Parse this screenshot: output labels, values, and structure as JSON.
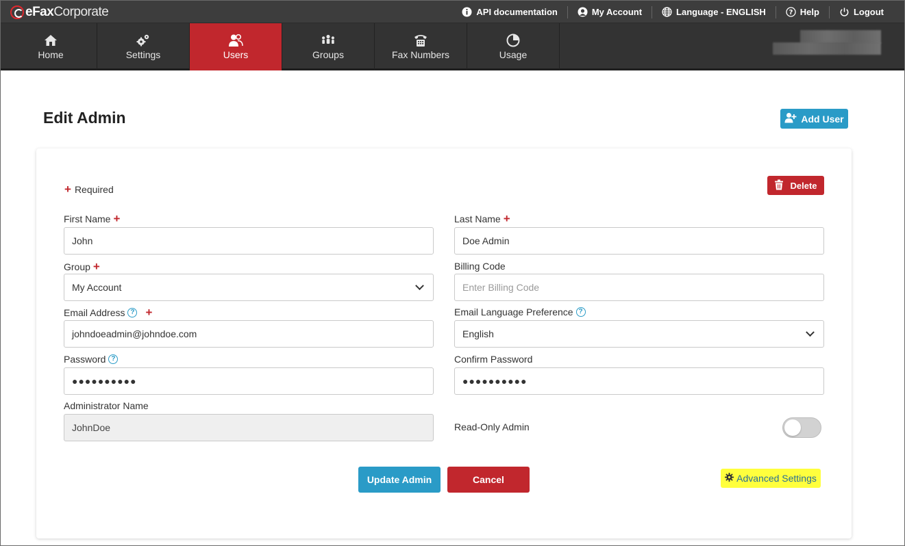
{
  "brand": {
    "logo_bold": "eFax",
    "logo_light": "Corporate"
  },
  "utility_nav": {
    "api_docs": "API documentation",
    "my_account": "My Account",
    "language": "Language - ENGLISH",
    "help": "Help",
    "logout": "Logout"
  },
  "main_nav": {
    "tabs": [
      {
        "label": "Home",
        "icon": "home-icon",
        "active": false
      },
      {
        "label": "Settings",
        "icon": "gears-icon",
        "active": false
      },
      {
        "label": "Users",
        "icon": "users-icon",
        "active": true
      },
      {
        "label": "Groups",
        "icon": "groups-icon",
        "active": false
      },
      {
        "label": "Fax Numbers",
        "icon": "fax-phone-icon",
        "active": false
      },
      {
        "label": "Usage",
        "icon": "pie-chart-icon",
        "active": false
      }
    ]
  },
  "page": {
    "title": "Edit Admin",
    "add_user_label": "Add User"
  },
  "form": {
    "required_note": "Required",
    "delete_label": "Delete",
    "first_name": {
      "label": "First Name",
      "value": "John",
      "required": true
    },
    "last_name": {
      "label": "Last Name",
      "value": "Doe Admin",
      "required": true
    },
    "group": {
      "label": "Group",
      "value": "My Account",
      "required": true
    },
    "billing_code": {
      "label": "Billing Code",
      "value": "",
      "placeholder": "Enter Billing Code"
    },
    "email": {
      "label": "Email Address",
      "value": "johndoeadmin@johndoe.com",
      "required": true
    },
    "email_language": {
      "label": "Email Language Preference",
      "value": "English"
    },
    "password": {
      "label": "Password",
      "value": "●●●●●●●●●●"
    },
    "confirm_password": {
      "label": "Confirm Password",
      "value": "●●●●●●●●●●"
    },
    "admin_name": {
      "label": "Administrator Name",
      "value": "JohnDoe"
    },
    "read_only": {
      "label": "Read-Only Admin",
      "enabled": false
    },
    "update_label": "Update Admin",
    "cancel_label": "Cancel",
    "advanced_label": "Advanced Settings"
  },
  "colors": {
    "accent_blue": "#2a9bc7",
    "brand_red": "#c1272d",
    "nav_bg": "#333333",
    "highlight_yellow": "#ffff3d"
  }
}
